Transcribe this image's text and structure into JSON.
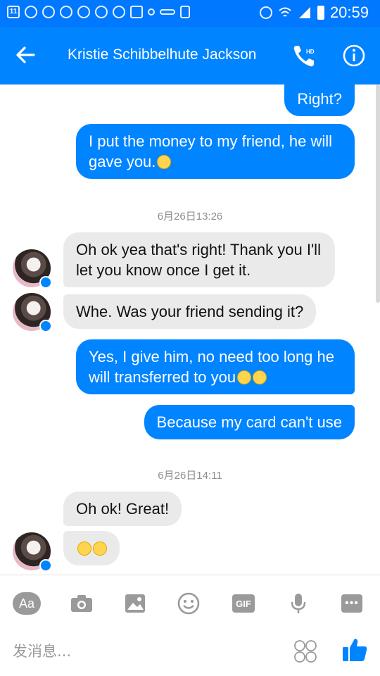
{
  "status_bar": {
    "icons": [
      "notification-count-icon",
      "weibo-icon",
      "messenger-icon",
      "search-icon",
      "weibo-icon",
      "weibo-icon",
      "weibo-icon",
      "image-icon",
      "android-icon",
      "key-icon",
      "phone-icon",
      "alarm-icon",
      "wifi-icon",
      "signal-icon",
      "battery-icon"
    ],
    "notification_count": "11",
    "time": "20:59"
  },
  "header": {
    "title": "Kristie Schibbelhute Jackson",
    "call_badge": "HD",
    "accent": "#0084ff"
  },
  "thread": {
    "messages": [
      {
        "from": "me",
        "text": "Right?"
      },
      {
        "from": "me",
        "text": "I put the money to my friend, he will gave you.",
        "emoji": [
          "grimace"
        ]
      },
      {
        "type": "timestamp",
        "text": "6月26日13:26"
      },
      {
        "from": "them",
        "text": "Oh ok yea that's right! Thank you I'll let you know once I get it."
      },
      {
        "from": "them",
        "text": "Whe. Was your friend sending it?"
      },
      {
        "from": "me",
        "text": "Yes, I give him, no need too long he will transferred to you",
        "emoji": [
          "grimace",
          "grimace"
        ]
      },
      {
        "from": "me",
        "text": "Because my card can't use"
      },
      {
        "type": "timestamp",
        "text": "6月26日14:11"
      },
      {
        "from": "them",
        "text": "Oh ok! Great!"
      },
      {
        "from": "them",
        "text": "",
        "emoji": [
          "smile",
          "blush"
        ]
      }
    ]
  },
  "composer": {
    "aa_label": "Aa",
    "gif_label": "GIF",
    "more_label": "•••",
    "placeholder": "发消息...",
    "tools": [
      "text-size-icon",
      "camera-icon",
      "image-icon",
      "emoji-icon",
      "gif-icon",
      "microphone-icon",
      "more-icon"
    ]
  },
  "colors": {
    "outgoing": "#0084ff",
    "incoming": "#eaeaea",
    "status_bar": "#0078ff"
  }
}
